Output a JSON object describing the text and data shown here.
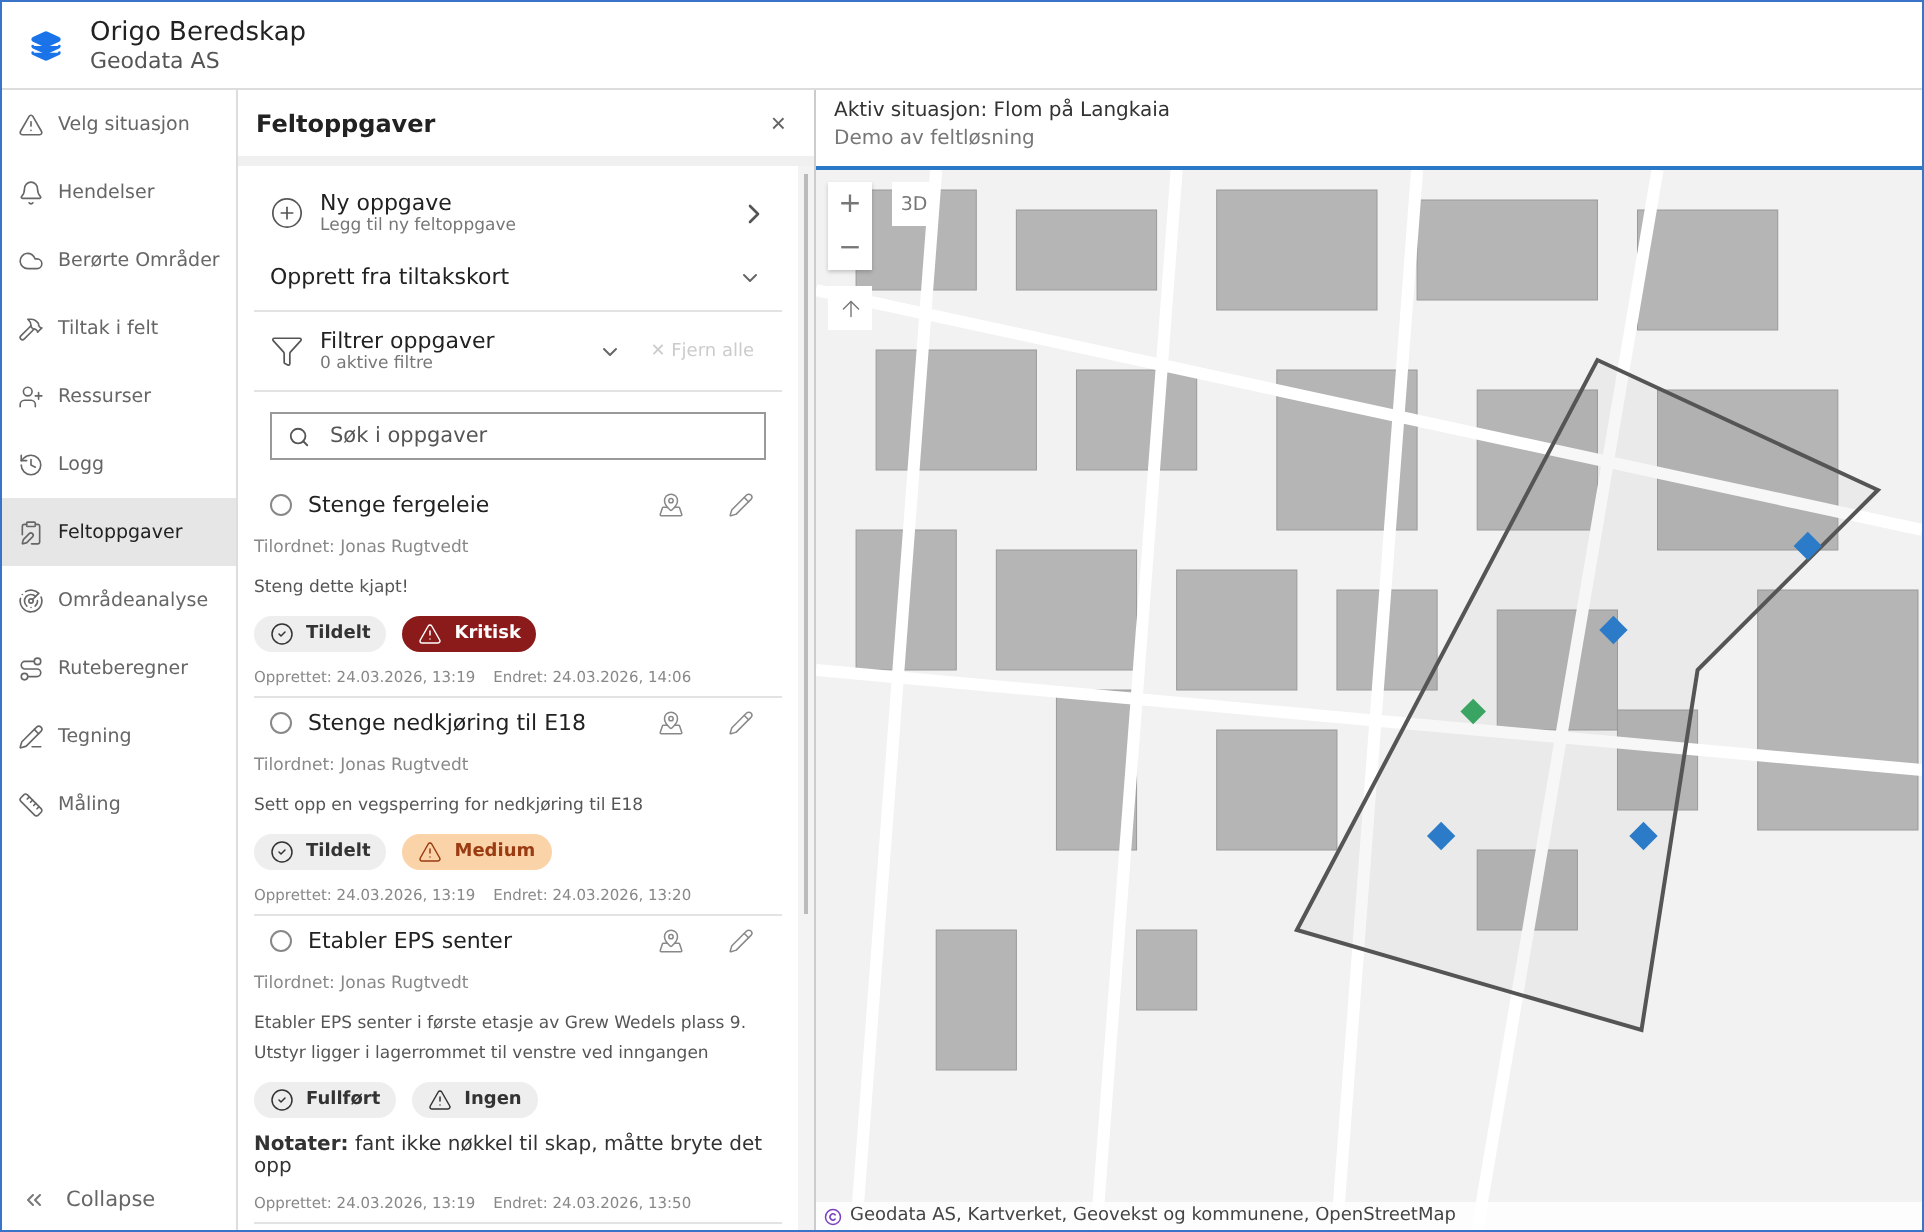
{
  "header": {
    "title": "Origo Beredskap",
    "subtitle": "Geodata AS"
  },
  "sidebar": {
    "items": [
      {
        "label": "Velg situasjon",
        "selected": false
      },
      {
        "label": "Hendelser",
        "selected": false
      },
      {
        "label": "Berørte Områder",
        "selected": false
      },
      {
        "label": "Tiltak i felt",
        "selected": false
      },
      {
        "label": "Ressurser",
        "selected": false
      },
      {
        "label": "Logg",
        "selected": false
      },
      {
        "label": "Feltoppgaver",
        "selected": true
      },
      {
        "label": "Områdeanalyse",
        "selected": false
      },
      {
        "label": "Ruteberegner",
        "selected": false
      },
      {
        "label": "Tegning",
        "selected": false
      },
      {
        "label": "Måling",
        "selected": false
      }
    ],
    "collapse": "Collapse"
  },
  "panel": {
    "title": "Feltoppgaver",
    "close": "×",
    "new_task": {
      "title": "Ny oppgave",
      "subtitle": "Legg til ny feltoppgave"
    },
    "create_from": "Opprett fra tiltakskort",
    "filter": {
      "title": "Filtrer oppgaver",
      "subtitle": "0 aktive filtre",
      "clear": "✕ Fjern alle",
      "clear_disabled": true
    },
    "search": {
      "placeholder": "Søk i oppgaver"
    },
    "tasks": [
      {
        "title": "Stenge fergeleie",
        "checked": false,
        "assignee": "Tilordnet: Jonas Rugtvedt",
        "description": "Steng dette kjapt!",
        "status": "Tildelt",
        "priority": "Kritisk",
        "kind": "critical",
        "created": "Opprettet: 24.03.2026, 13:19",
        "changed": "Endret: 24.03.2026, 14:06"
      },
      {
        "title": "Stenge nedkjøring til E18",
        "checked": false,
        "assignee": "Tilordnet: Jonas Rugtvedt",
        "description": "Sett opp en vegsperring for nedkjøring til E18",
        "status": "Tildelt",
        "priority": "Medium",
        "kind": "medium",
        "created": "Opprettet: 24.03.2026, 13:19",
        "changed": "Endret: 24.03.2026, 13:20"
      },
      {
        "title": "Etabler EPS senter",
        "checked": false,
        "assignee": "Tilordnet: Jonas Rugtvedt",
        "description": "Etabler EPS senter i første etasje av Grew Wedels plass 9. Utstyr ligger i lagerrommet til venstre ved inngangen",
        "status": "Fullført",
        "priority": "Ingen",
        "kind": "none",
        "notes": "**Notater:** fant ikke nøkkel til skap, måtte bryte det opp",
        "created": "Opprettet: 24.03.2026, 13:19",
        "changed": "Endret: 24.03.2026, 13:50"
      }
    ]
  },
  "map": {
    "situation": "Aktiv situasjon: Flom på Langkaia",
    "subtitle": "Demo av feltløsning",
    "zoom_in": "+",
    "zoom_out": "−",
    "view_3d": "3D",
    "attribution": "Geodata AS, Kartverket, Geovekst og kommunene, OpenStreetMap"
  }
}
